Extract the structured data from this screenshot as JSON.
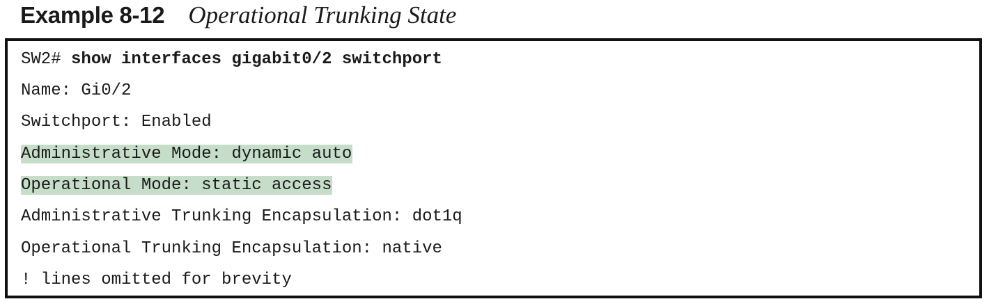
{
  "heading": {
    "label": "Example 8-12",
    "title": "Operational Trunking State"
  },
  "colors": {
    "highlight": "#c5ddc9",
    "text": "#1a1a1a",
    "border": "#111111"
  },
  "code": {
    "prompt": "SW2# ",
    "command": "show interfaces gigabit0/2 switchport",
    "lines": [
      "Name: Gi0/2",
      "Switchport: Enabled",
      "Administrative Mode: dynamic auto",
      "Operational Mode: static access",
      "Administrative Trunking Encapsulation: dot1q",
      "Operational Trunking Encapsulation: native",
      "! lines omitted for brevity"
    ]
  }
}
